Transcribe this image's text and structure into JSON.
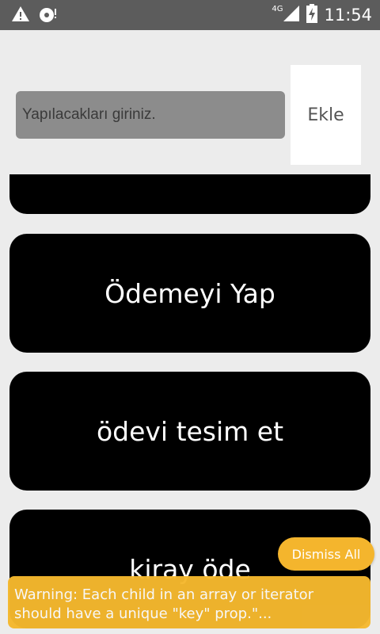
{
  "status_bar": {
    "network": "4G",
    "time": "11:54",
    "icons": [
      "warning-icon",
      "sd-card-alert-icon",
      "signal-icon",
      "battery-charging-icon"
    ]
  },
  "todo_input": {
    "placeholder": "Yapılacakları giriniz.",
    "value": ""
  },
  "add_button": {
    "label": "Ekle"
  },
  "todos": [
    {
      "text": ""
    },
    {
      "text": "Ödemeyi Yap"
    },
    {
      "text": "ödevi tesim et"
    },
    {
      "text": "kiray öde"
    }
  ],
  "warning": {
    "message": "Warning: Each child in an array or iterator should have a unique \"key\" prop.\"...",
    "line1": "Warning: Each child in an array or iterator",
    "line2": "should have a unique \"key\" prop.\"...",
    "dismiss_label": "Dismiss All"
  },
  "colors": {
    "status_bar": "#5c5c5c",
    "background": "#ececec",
    "item_background": "#000000",
    "warning": "#f5b82e"
  }
}
